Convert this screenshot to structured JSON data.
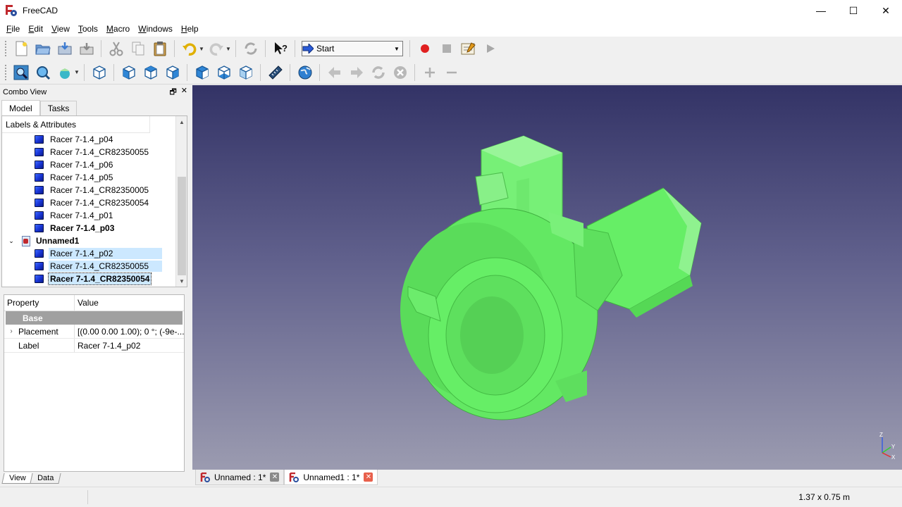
{
  "window": {
    "title": "FreeCAD",
    "controls": {
      "minimize": "—",
      "maximize": "☐",
      "close": "✕"
    }
  },
  "menu": [
    {
      "first": "F",
      "rest": "ile"
    },
    {
      "first": "E",
      "rest": "dit"
    },
    {
      "first": "V",
      "rest": "iew"
    },
    {
      "first": "T",
      "rest": "ools"
    },
    {
      "first": "M",
      "rest": "acro"
    },
    {
      "first": "W",
      "rest": "indows"
    },
    {
      "first": "H",
      "rest": "elp"
    }
  ],
  "workbench": {
    "selected": "Start"
  },
  "combo_view": {
    "title": "Combo View",
    "tabs": [
      "Model",
      "Tasks"
    ],
    "tree_header": "Labels & Attributes",
    "tree_items": [
      {
        "label": "Racer 7-1.4_p04"
      },
      {
        "label": "Racer 7-1.4_CR82350055"
      },
      {
        "label": "Racer 7-1.4_p06"
      },
      {
        "label": "Racer 7-1.4_p05"
      },
      {
        "label": "Racer 7-1.4_CR82350005"
      },
      {
        "label": "Racer 7-1.4_CR82350054"
      },
      {
        "label": "Racer 7-1.4_p01"
      },
      {
        "label": "Racer 7-1.4_p03"
      },
      {
        "label": "Unnamed1"
      },
      {
        "label": "Racer 7-1.4_p02"
      },
      {
        "label": "Racer 7-1.4_CR82350055"
      },
      {
        "label": "Racer 7-1.4_CR82350054"
      }
    ]
  },
  "property_view": {
    "col_property": "Property",
    "col_value": "Value",
    "group": "Base",
    "rows": [
      {
        "name": "Placement",
        "value": "[(0.00 0.00 1.00); 0 °; (-9e-..."
      },
      {
        "name": "Label",
        "value": "Racer 7-1.4_p02"
      }
    ],
    "tabs": [
      "View",
      "Data"
    ]
  },
  "document_tabs": [
    {
      "label": "Unnamed : 1*"
    },
    {
      "label": "Unnamed1 : 1*"
    }
  ],
  "status": {
    "dimensions": "1.37 x 0.75 m"
  },
  "colors": {
    "model_green": "#66ee66",
    "viewport_top": "#333366",
    "viewport_bottom": "#9b9bb0",
    "selection": "#cce8ff",
    "record_red": "#e02020"
  },
  "axis_labels": {
    "x": "X",
    "y": "Y",
    "z": "Z"
  }
}
